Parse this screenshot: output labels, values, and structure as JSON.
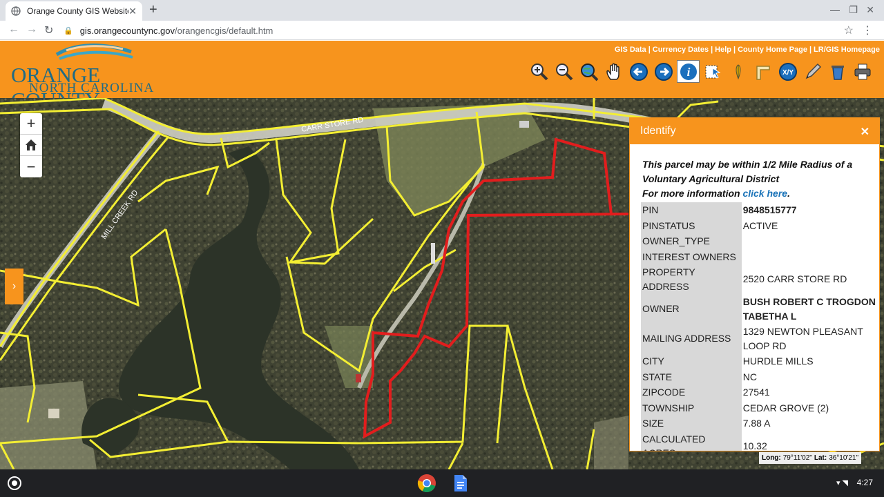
{
  "browser": {
    "tab_title": "Orange County GIS Website",
    "url_host": "gis.orangecountync.gov",
    "url_path": "/orangencgis/default.htm"
  },
  "site": {
    "logo_line1": "ORANGE COUNTY",
    "logo_line2": "NORTH CAROLINA",
    "links": [
      "GIS Data",
      "Currency Dates",
      "Help",
      "County Home Page",
      "LR/GIS Homepage"
    ],
    "tools": [
      "zoom-in-icon",
      "zoom-out-icon",
      "full-extent-icon",
      "pan-icon",
      "previous-extent-icon",
      "next-extent-icon",
      "identify-icon",
      "select-icon",
      "locate-icon",
      "measure-icon",
      "xy-icon",
      "draw-icon",
      "clear-icon",
      "print-icon"
    ],
    "active_tool": "identify-icon",
    "accent_color": "#f7941d",
    "text_color": "#1f6b85"
  },
  "map": {
    "road_labels": [
      "CARR STORE RD",
      "MILL CREEK RD"
    ],
    "coords": {
      "long_label": "Long:",
      "long_value": "79°11'02\"",
      "lat_label": "Lat:",
      "lat_value": "36°10'21\""
    },
    "parcel_line_color": "#f3ee33",
    "selected_parcel_color": "#e21d1d"
  },
  "identify": {
    "title": "Identify",
    "notice_line1": "This parcel may be within 1/2 Mile Radius of a Voluntary Agricultural District",
    "notice_line2": "For more information ",
    "notice_link": "click here",
    "notice_end": ".",
    "rows": [
      {
        "key": "PIN",
        "value": "9848515777",
        "bold": true
      },
      {
        "key": "PINSTATUS",
        "value": "ACTIVE"
      },
      {
        "key": "OWNER_TYPE",
        "value": ""
      },
      {
        "key": "INTEREST OWNERS",
        "value": ""
      },
      {
        "key": "PROPERTY ADDRESS",
        "value": "2520 CARR STORE RD"
      },
      {
        "key": "OWNER",
        "value": "BUSH ROBERT C TROGDON TABETHA L",
        "bold": true
      },
      {
        "key": "MAILING ADDRESS",
        "value": "1329 NEWTON PLEASANT LOOP RD"
      },
      {
        "key": "CITY",
        "value": "HURDLE MILLS"
      },
      {
        "key": "STATE",
        "value": "NC"
      },
      {
        "key": "ZIPCODE",
        "value": "27541"
      },
      {
        "key": "TOWNSHIP",
        "value": "CEDAR GROVE (2)"
      },
      {
        "key": "SIZE",
        "value": "7.88 A"
      },
      {
        "key": "CALCULATED ACRES",
        "value": "10.32"
      }
    ]
  },
  "shelf": {
    "time": "4:27",
    "apps": [
      "chrome-icon",
      "docs-icon"
    ]
  }
}
